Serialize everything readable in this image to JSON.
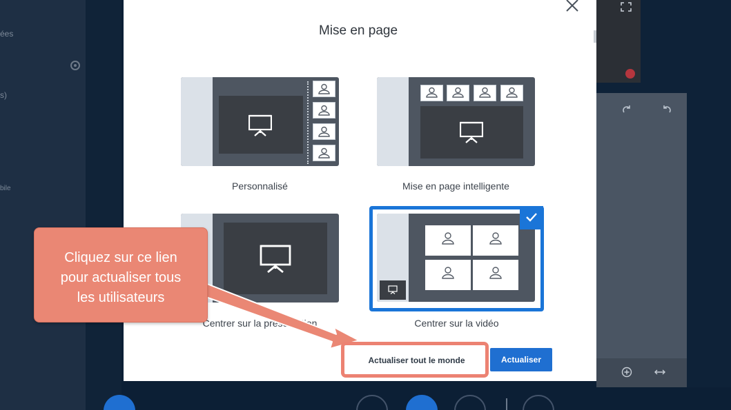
{
  "background": {
    "left_panel": {
      "items": [
        "ées",
        "s)",
        "bile"
      ]
    }
  },
  "modal": {
    "title": "Mise en page",
    "layouts": [
      {
        "label": "Personnalisé",
        "selected": false
      },
      {
        "label": "Mise en page intelligente",
        "selected": false
      },
      {
        "label": "Centrer sur la présentation",
        "selected": false
      },
      {
        "label": "Centrer sur la vidéo",
        "selected": true
      }
    ],
    "buttons": {
      "update_all": "Actualiser tout le monde",
      "update": "Actualiser"
    }
  },
  "tutorial": {
    "callout_lines": [
      "Cliquez sur ce lien",
      "pour actualiser tous",
      "les utilisateurs"
    ]
  },
  "colors": {
    "accent": "#1f6fd1",
    "callout": "#ea8774",
    "highlight": "#ec8272"
  }
}
